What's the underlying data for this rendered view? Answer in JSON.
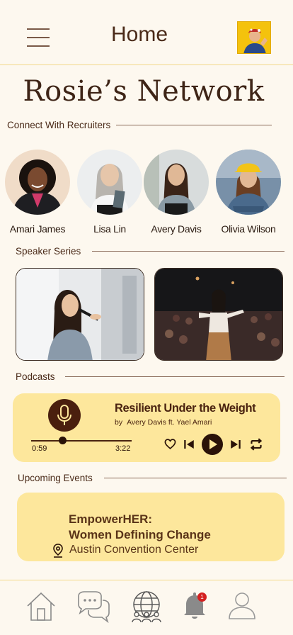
{
  "header": {
    "title": "Home"
  },
  "network": {
    "title": "Rosie’s Network"
  },
  "recruiters": {
    "label": "Connect With Recruiters",
    "items": [
      {
        "name": "Amari James"
      },
      {
        "name": "Lisa Lin"
      },
      {
        "name": "Avery Davis"
      },
      {
        "name": "Olivia Wilson"
      }
    ]
  },
  "speakers": {
    "label": "Speaker Series"
  },
  "podcasts": {
    "label": "Podcasts",
    "title": "Resilient Under the Weight",
    "by": "by",
    "authors": "Avery Davis ft. Yael Amari",
    "elapsed": "0:59",
    "duration": "3:22",
    "progress": 0.31
  },
  "events": {
    "label": "Upcoming Events",
    "title_line1": "EmpowerHER:",
    "title_line2": "Women Defining Change",
    "location": "Austin Convention Center"
  },
  "tabs": {
    "notification_count": "1"
  },
  "colors": {
    "background": "#fdf8ef",
    "card": "#fde79c",
    "accent_brown": "#4a2310",
    "divider": "#f3d98a",
    "badge": "#d42020"
  }
}
